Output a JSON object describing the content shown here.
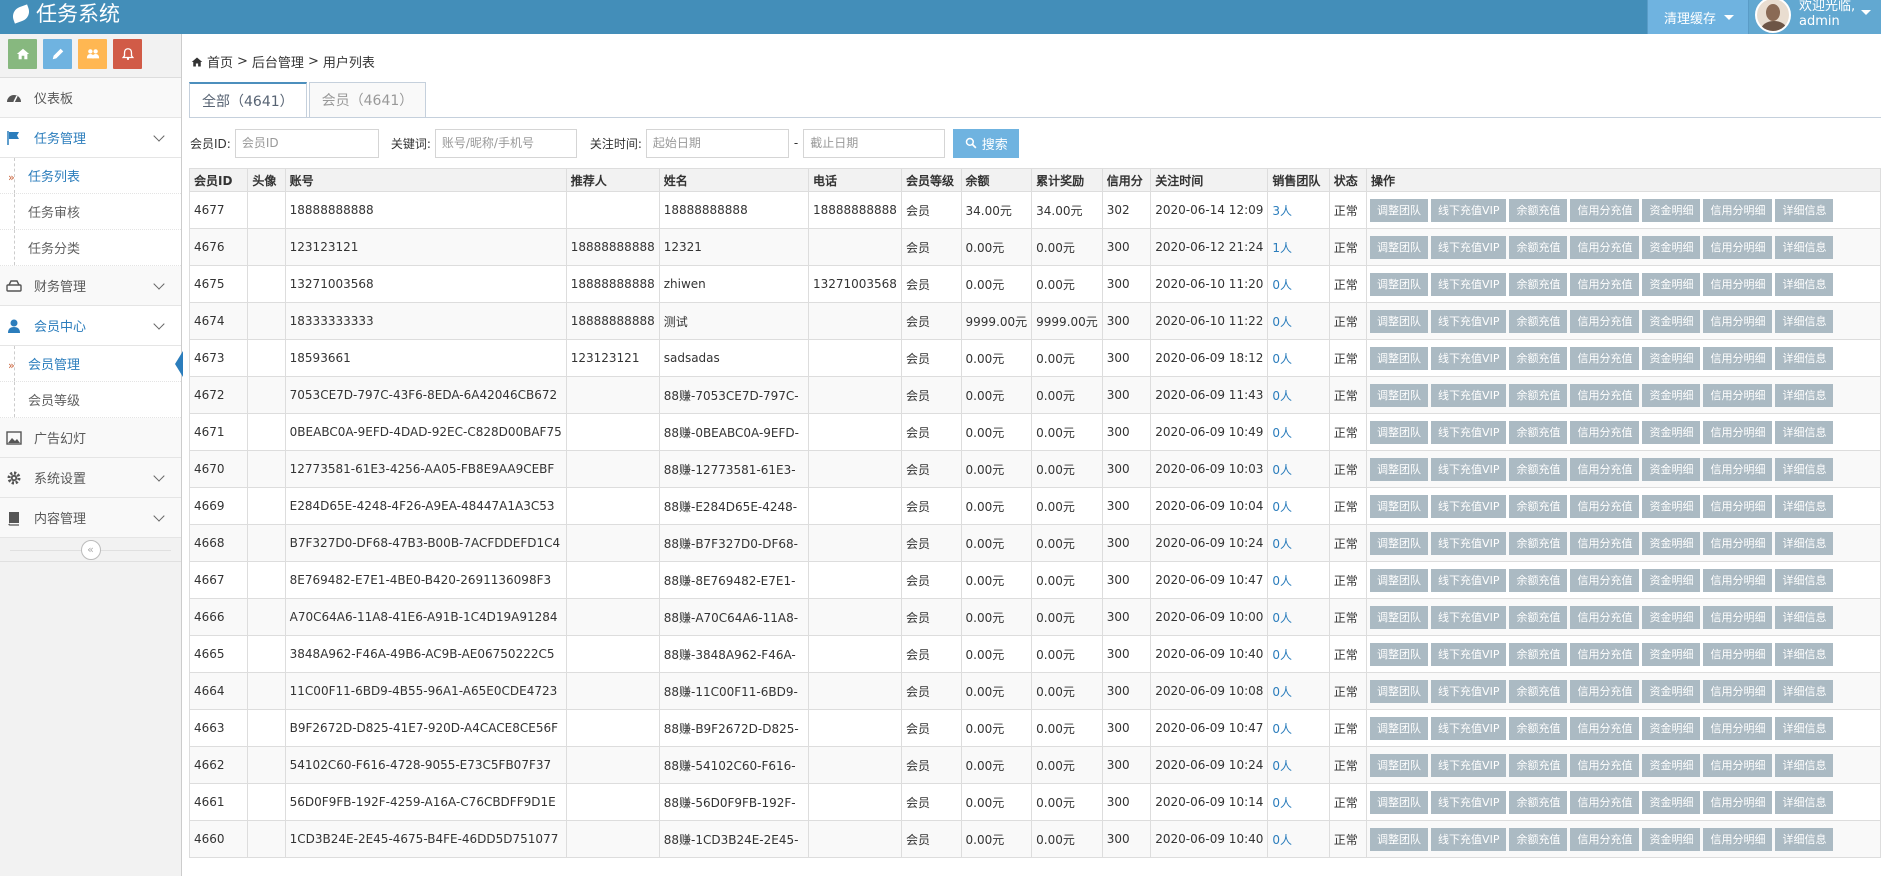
{
  "app": {
    "title": "任务系统"
  },
  "navbar": {
    "cache_label": "清理缓存",
    "welcome": "欢迎光临,",
    "user": "admin"
  },
  "colors": {
    "navbar": "#438eb9",
    "accent": "#2b7dbc",
    "op_button": "#abbac3",
    "search_button": "#6fb3e0"
  },
  "shortcuts": [
    {
      "name": "home-icon",
      "color": "#87b87f"
    },
    {
      "name": "pencil-icon",
      "color": "#6fb3e0"
    },
    {
      "name": "users-icon",
      "color": "#ffb752"
    },
    {
      "name": "bell-icon",
      "color": "#d15b47"
    }
  ],
  "sidebar": {
    "dashboard": "仪表板",
    "task_mgmt": "任务管理",
    "task_list": "任务列表",
    "task_review": "任务审核",
    "task_category": "任务分类",
    "finance": "财务管理",
    "member_center": "会员中心",
    "member_mgmt": "会员管理",
    "member_level": "会员等级",
    "ads": "广告幻灯",
    "settings": "系统设置",
    "content": "内容管理"
  },
  "breadcrumb": {
    "home": "首页",
    "sep1": ">",
    "admin": "后台管理",
    "sep2": ">",
    "current": "用户列表"
  },
  "tabs": [
    {
      "label": "全部（4641）"
    },
    {
      "label": "会员（4641）"
    }
  ],
  "filter": {
    "member_id_label": "会员ID:",
    "member_id_placeholder": "会员ID",
    "keyword_label": "关键词:",
    "keyword_placeholder": "账号/昵称/手机号",
    "time_label": "关注时间:",
    "start_placeholder": "起始日期",
    "dash": "-",
    "end_placeholder": "截止日期",
    "search_label": "搜索"
  },
  "table": {
    "headers": [
      "会员ID",
      "头像",
      "账号",
      "推荐人",
      "姓名",
      "电话",
      "会员等级",
      "余额",
      "累计奖励",
      "信用分",
      "关注时间",
      "销售团队",
      "状态",
      "操作"
    ],
    "op_labels": [
      "调整团队",
      "线下充值VIP",
      "余额充值",
      "信用分充值",
      "资金明细",
      "信用分明细",
      "详细信息"
    ],
    "rows": [
      [
        "4677",
        "",
        "18888888888",
        "",
        "18888888888",
        "18888888888",
        "会员",
        "34.00元",
        "34.00元",
        "302",
        "2020-06-14 12:09",
        "3人",
        "正常"
      ],
      [
        "4676",
        "",
        "123123121",
        "18888888888",
        "12321",
        "",
        "会员",
        "0.00元",
        "0.00元",
        "300",
        "2020-06-12 21:24",
        "1人",
        "正常"
      ],
      [
        "4675",
        "",
        "13271003568",
        "18888888888",
        "zhiwen",
        "13271003568",
        "会员",
        "0.00元",
        "0.00元",
        "300",
        "2020-06-10 11:20",
        "0人",
        "正常"
      ],
      [
        "4674",
        "",
        "18333333333",
        "18888888888",
        "测试",
        "",
        "会员",
        "9999.00元",
        "9999.00元",
        "300",
        "2020-06-10 11:22",
        "0人",
        "正常"
      ],
      [
        "4673",
        "",
        "18593661",
        "123123121",
        "sadsadas",
        "",
        "会员",
        "0.00元",
        "0.00元",
        "300",
        "2020-06-09 18:12",
        "0人",
        "正常"
      ],
      [
        "4672",
        "",
        "7053CE7D-797C-43F6-8EDA-6A42046CB672",
        "",
        "88赚-7053CE7D-797C-",
        "",
        "会员",
        "0.00元",
        "0.00元",
        "300",
        "2020-06-09 11:43",
        "0人",
        "正常"
      ],
      [
        "4671",
        "",
        "0BEABC0A-9EFD-4DAD-92EC-C828D00BAF75",
        "",
        "88赚-0BEABC0A-9EFD-",
        "",
        "会员",
        "0.00元",
        "0.00元",
        "300",
        "2020-06-09 10:49",
        "0人",
        "正常"
      ],
      [
        "4670",
        "",
        "12773581-61E3-4256-AA05-FB8E9AA9CEBF",
        "",
        "88赚-12773581-61E3-",
        "",
        "会员",
        "0.00元",
        "0.00元",
        "300",
        "2020-06-09 10:03",
        "0人",
        "正常"
      ],
      [
        "4669",
        "",
        "E284D65E-4248-4F26-A9EA-48447A1A3C53",
        "",
        "88赚-E284D65E-4248-",
        "",
        "会员",
        "0.00元",
        "0.00元",
        "300",
        "2020-06-09 10:04",
        "0人",
        "正常"
      ],
      [
        "4668",
        "",
        "B7F327D0-DF68-47B3-B00B-7ACFDDEFD1C4",
        "",
        "88赚-B7F327D0-DF68-",
        "",
        "会员",
        "0.00元",
        "0.00元",
        "300",
        "2020-06-09 10:24",
        "0人",
        "正常"
      ],
      [
        "4667",
        "",
        "8E769482-E7E1-4BE0-B420-2691136098F3",
        "",
        "88赚-8E769482-E7E1-",
        "",
        "会员",
        "0.00元",
        "0.00元",
        "300",
        "2020-06-09 10:47",
        "0人",
        "正常"
      ],
      [
        "4666",
        "",
        "A70C64A6-11A8-41E6-A91B-1C4D19A91284",
        "",
        "88赚-A70C64A6-11A8-",
        "",
        "会员",
        "0.00元",
        "0.00元",
        "300",
        "2020-06-09 10:00",
        "0人",
        "正常"
      ],
      [
        "4665",
        "",
        "3848A962-F46A-49B6-AC9B-AE06750222C5",
        "",
        "88赚-3848A962-F46A-",
        "",
        "会员",
        "0.00元",
        "0.00元",
        "300",
        "2020-06-09 10:40",
        "0人",
        "正常"
      ],
      [
        "4664",
        "",
        "11C00F11-6BD9-4B55-96A1-A65E0CDE4723",
        "",
        "88赚-11C00F11-6BD9-",
        "",
        "会员",
        "0.00元",
        "0.00元",
        "300",
        "2020-06-09 10:08",
        "0人",
        "正常"
      ],
      [
        "4663",
        "",
        "B9F2672D-D825-41E7-920D-A4CACE8CE56F",
        "",
        "88赚-B9F2672D-D825-",
        "",
        "会员",
        "0.00元",
        "0.00元",
        "300",
        "2020-06-09 10:47",
        "0人",
        "正常"
      ],
      [
        "4662",
        "",
        "54102C60-F616-4728-9055-E73C5FB07F37",
        "",
        "88赚-54102C60-F616-",
        "",
        "会员",
        "0.00元",
        "0.00元",
        "300",
        "2020-06-09 10:24",
        "0人",
        "正常"
      ],
      [
        "4661",
        "",
        "56D0F9FB-192F-4259-A16A-C76CBDFF9D1E",
        "",
        "88赚-56D0F9FB-192F-",
        "",
        "会员",
        "0.00元",
        "0.00元",
        "300",
        "2020-06-09 10:14",
        "0人",
        "正常"
      ],
      [
        "4660",
        "",
        "1CD3B24E-2E45-4675-B4FE-46DD5D751077",
        "",
        "88赚-1CD3B24E-2E45-",
        "",
        "会员",
        "0.00元",
        "0.00元",
        "300",
        "2020-06-09 10:40",
        "0人",
        "正常"
      ]
    ]
  }
}
